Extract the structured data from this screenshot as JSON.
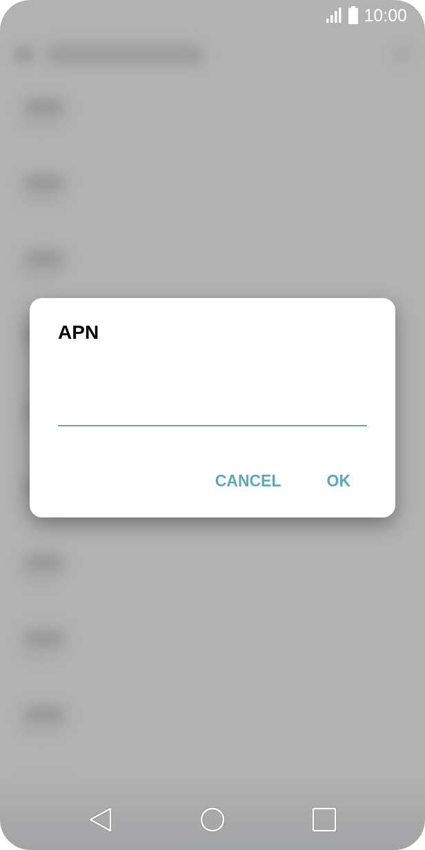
{
  "status_bar": {
    "time": "10:00"
  },
  "dialog": {
    "title": "APN",
    "field": {
      "focused": true
    },
    "buttons": [
      {
        "label": "CANCEL"
      },
      {
        "label": "OK"
      }
    ]
  }
}
